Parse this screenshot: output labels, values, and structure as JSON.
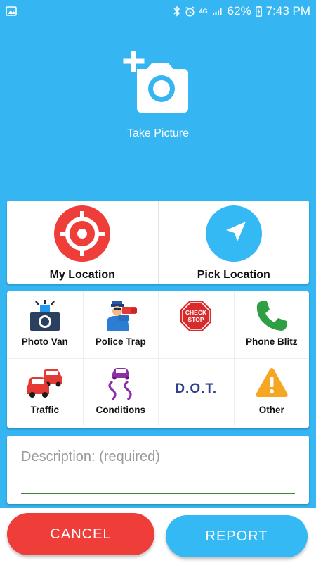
{
  "status_bar": {
    "battery": "62%",
    "time": "7:43 PM",
    "network_label": "4G"
  },
  "take_picture": {
    "label": "Take Picture",
    "icon": "add-photo-icon"
  },
  "location": {
    "my_location": {
      "label": "My Location",
      "icon": "crosshair-icon",
      "color": "#ef3e39"
    },
    "pick_location": {
      "label": "Pick Location",
      "icon": "navigation-arrow-icon",
      "color": "#34b9f4"
    }
  },
  "categories": [
    {
      "label": "Photo Van",
      "icon": "photo-van-icon"
    },
    {
      "label": "Police Trap",
      "icon": "police-trap-icon"
    },
    {
      "label": "",
      "icon": "check-stop-sign-icon",
      "sign_text_1": "CHECK",
      "sign_text_2": "STOP"
    },
    {
      "label": "Phone Blitz",
      "icon": "phone-icon"
    },
    {
      "label": "Traffic",
      "icon": "traffic-cars-icon"
    },
    {
      "label": "Conditions",
      "icon": "slippery-road-icon"
    },
    {
      "label": "",
      "icon": "dot-text-icon",
      "text": "D.O.T."
    },
    {
      "label": "Other",
      "icon": "warning-icon"
    }
  ],
  "description": {
    "placeholder": "Description: (required)",
    "value": ""
  },
  "buttons": {
    "cancel": "CANCEL",
    "report": "REPORT"
  },
  "colors": {
    "background": "#35b6f2",
    "cancel": "#ef3e39",
    "report": "#34b9f4"
  }
}
